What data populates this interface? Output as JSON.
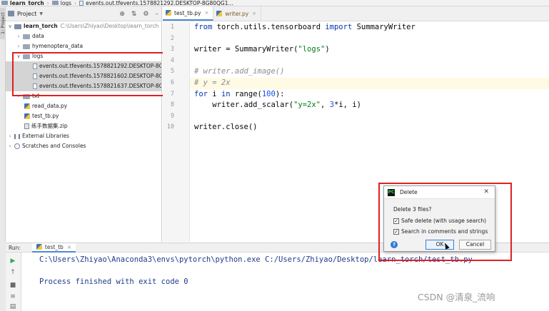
{
  "breadcrumb": {
    "project": "learn_torch",
    "folder": "logs",
    "file": "events.out.tfevents.1578821292.DESKTOP-8G80QG1..."
  },
  "left_stripe": {
    "label": "1: Project"
  },
  "project_panel": {
    "title": "Project",
    "items": [
      {
        "label": "learn_torch",
        "path": "C:\\Users\\Zhiyao\\Desktop\\learn_torch",
        "type": "root-folder",
        "expanded": true
      },
      {
        "label": "data",
        "type": "folder",
        "expanded": false
      },
      {
        "label": "hymenoptera_data",
        "type": "folder",
        "expanded": false
      },
      {
        "label": "logs",
        "type": "folder",
        "expanded": true
      },
      {
        "label": "events.out.tfevents.1578821292.DESKTOP-8C",
        "type": "file",
        "selected": true
      },
      {
        "label": "events.out.tfevents.1578821602.DESKTOP-8C",
        "type": "file",
        "selected": true
      },
      {
        "label": "events.out.tfevents.1578821637.DESKTOP-8C",
        "type": "file",
        "selected": true
      },
      {
        "label": "txt",
        "type": "folder",
        "expanded": false
      },
      {
        "label": "read_data.py",
        "type": "py"
      },
      {
        "label": "test_tb.py",
        "type": "py"
      },
      {
        "label": "练手数据集.zip",
        "type": "zip"
      },
      {
        "label": "External Libraries",
        "type": "lib"
      },
      {
        "label": "Scratches and Consoles",
        "type": "scratch"
      }
    ]
  },
  "editor": {
    "tabs": [
      {
        "label": "test_tb.py",
        "active": true
      },
      {
        "label": "writer.py",
        "active": false
      }
    ],
    "line_numbers": [
      "1",
      "2",
      "3",
      "4",
      "5",
      "6",
      "7",
      "8",
      "9",
      "10"
    ]
  },
  "run_panel": {
    "label": "Run:",
    "tab": "test_tb",
    "lines": [
      "C:\\Users\\Zhiyao\\Anaconda3\\envs\\pytorch\\python.exe C:/Users/Zhiyao/Desktop/learn_torch/test_tb.py",
      "Process finished with exit code 0"
    ]
  },
  "dialog": {
    "title": "Delete",
    "question": "Delete 3 files?",
    "options": [
      {
        "label": "Safe delete (with usage search)",
        "checked": true
      },
      {
        "label": "Search in comments and strings",
        "checked": true
      }
    ],
    "ok_label": "OK",
    "cancel_label": "Cancel",
    "help_label": "?",
    "app_icon_text": "PC"
  },
  "watermark": "CSDN @清泉_流响",
  "colors": {
    "highlight_box": "#e02020",
    "keyword": "#0033b3",
    "string": "#067d17",
    "comment": "#8c8c8c",
    "number": "#1750eb",
    "console_text": "#1f3b8c"
  }
}
